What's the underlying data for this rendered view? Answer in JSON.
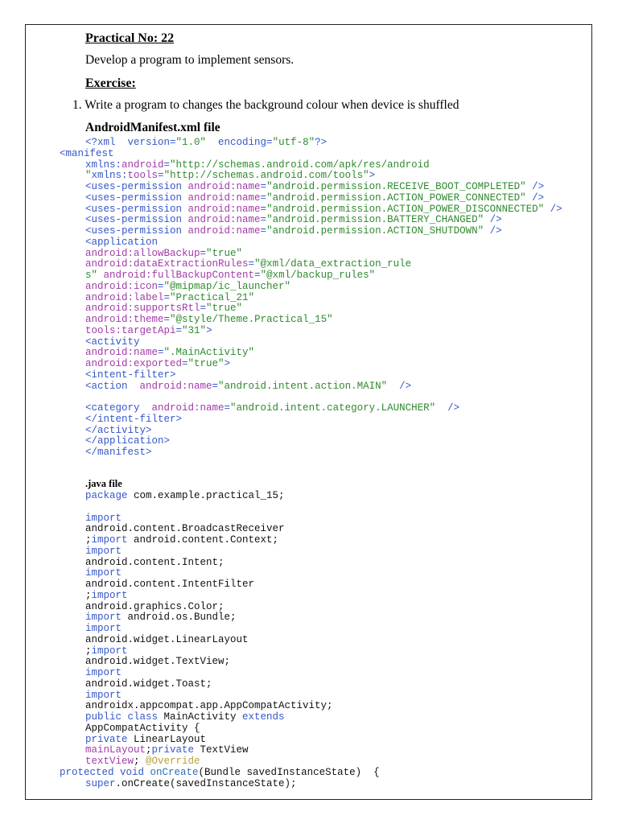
{
  "header": {
    "practical_title": "Practical No: 22",
    "aim": "Develop a program to implement sensors.",
    "exercise_heading": "Exercise:",
    "question": "1. Write a program to changes the background colour when device is shuffled",
    "manifest_heading": "AndroidManifest.xml file",
    "java_heading": ".java file"
  },
  "colors": {
    "tag": "#3557c8",
    "attr": "#a23aa8",
    "value": "#2f8a2f",
    "annotation": "#b8a03a"
  },
  "code": {
    "manifest": [
      {
        "indent": "i",
        "segs": [
          [
            "t",
            "<?xml  version="
          ],
          [
            "v",
            "\"1.0\""
          ],
          [
            "t",
            "  encoding="
          ],
          [
            "v",
            "\"utf-8\""
          ],
          [
            "t",
            "?>"
          ]
        ]
      },
      {
        "indent": "o",
        "segs": [
          [
            "t",
            "<manifest"
          ]
        ]
      },
      {
        "indent": "i",
        "segs": [
          [
            "t",
            "xmlns:"
          ],
          [
            "a",
            "android"
          ],
          [
            "t",
            "="
          ],
          [
            "v",
            "\"http://schemas.android.com/apk/res/android"
          ]
        ]
      },
      {
        "indent": "i",
        "segs": [
          [
            "v",
            "\""
          ],
          [
            "t",
            "xmlns:"
          ],
          [
            "a",
            "tools"
          ],
          [
            "t",
            "="
          ],
          [
            "v",
            "\"http://schemas.android.com/tools\""
          ],
          [
            "t",
            ">"
          ]
        ]
      },
      {
        "indent": "i",
        "segs": [
          [
            "t",
            "<uses-permission "
          ],
          [
            "a",
            "android:name"
          ],
          [
            "t",
            "="
          ],
          [
            "v",
            "\"android.permission.RECEIVE_BOOT_COMPLETED\""
          ],
          [
            "t",
            " />"
          ]
        ]
      },
      {
        "indent": "i",
        "segs": [
          [
            "t",
            "<uses-permission "
          ],
          [
            "a",
            "android:name"
          ],
          [
            "t",
            "="
          ],
          [
            "v",
            "\"android.permission.ACTION_POWER_CONNECTED\""
          ],
          [
            "t",
            " />"
          ]
        ]
      },
      {
        "indent": "i",
        "segs": [
          [
            "t",
            "<uses-permission "
          ],
          [
            "a",
            "android:name"
          ],
          [
            "t",
            "="
          ],
          [
            "v",
            "\"android.permission.ACTION_POWER_DISCONNECTED\""
          ],
          [
            "t",
            " />"
          ]
        ]
      },
      {
        "indent": "i",
        "segs": [
          [
            "t",
            "<uses-permission "
          ],
          [
            "a",
            "android:name"
          ],
          [
            "t",
            "="
          ],
          [
            "v",
            "\"android.permission.BATTERY_CHANGED\""
          ],
          [
            "t",
            " />"
          ]
        ]
      },
      {
        "indent": "i",
        "segs": [
          [
            "t",
            "<uses-permission "
          ],
          [
            "a",
            "android:name"
          ],
          [
            "t",
            "="
          ],
          [
            "v",
            "\"android.permission.ACTION_SHUTDOWN\""
          ],
          [
            "t",
            " />"
          ]
        ]
      },
      {
        "indent": "i",
        "segs": [
          [
            "t",
            "<application"
          ]
        ]
      },
      {
        "indent": "i",
        "segs": [
          [
            "a",
            "android:allowBackup"
          ],
          [
            "t",
            "="
          ],
          [
            "v",
            "\"true\""
          ]
        ]
      },
      {
        "indent": "i",
        "segs": [
          [
            "a",
            "android:dataExtractionRules"
          ],
          [
            "t",
            "="
          ],
          [
            "v",
            "\"@xml/data_extraction_rule"
          ]
        ]
      },
      {
        "indent": "i",
        "segs": [
          [
            "v",
            "s\" "
          ],
          [
            "a",
            "android:fullBackupContent"
          ],
          [
            "t",
            "="
          ],
          [
            "v",
            "\"@xml/backup_rules\""
          ]
        ]
      },
      {
        "indent": "i",
        "segs": [
          [
            "a",
            "android:icon"
          ],
          [
            "t",
            "="
          ],
          [
            "v",
            "\"@mipmap/ic_launcher\""
          ]
        ]
      },
      {
        "indent": "i",
        "segs": [
          [
            "a",
            "android:label"
          ],
          [
            "t",
            "="
          ],
          [
            "v",
            "\"Practical_21\""
          ]
        ]
      },
      {
        "indent": "i",
        "segs": [
          [
            "a",
            "android:supportsRtl"
          ],
          [
            "t",
            "="
          ],
          [
            "v",
            "\"true\""
          ]
        ]
      },
      {
        "indent": "i",
        "segs": [
          [
            "a",
            "android:theme"
          ],
          [
            "t",
            "="
          ],
          [
            "v",
            "\"@style/Theme.Practical_15\""
          ]
        ]
      },
      {
        "indent": "i",
        "segs": [
          [
            "a",
            "tools:targetApi"
          ],
          [
            "t",
            "="
          ],
          [
            "v",
            "\"31\""
          ],
          [
            "t",
            ">"
          ]
        ]
      },
      {
        "indent": "i",
        "segs": [
          [
            "t",
            "<activity"
          ]
        ]
      },
      {
        "indent": "i",
        "segs": [
          [
            "a",
            "android:name"
          ],
          [
            "t",
            "="
          ],
          [
            "v",
            "\".MainActivity\""
          ]
        ]
      },
      {
        "indent": "i",
        "segs": [
          [
            "a",
            "android:exported"
          ],
          [
            "t",
            "="
          ],
          [
            "v",
            "\"true\""
          ],
          [
            "t",
            ">"
          ]
        ]
      },
      {
        "indent": "i",
        "segs": [
          [
            "t",
            "<intent-filter>"
          ]
        ]
      },
      {
        "indent": "i",
        "segs": [
          [
            "t",
            "<action  "
          ],
          [
            "a",
            "android:name"
          ],
          [
            "t",
            "="
          ],
          [
            "v",
            "\"android.intent.action.MAIN\""
          ],
          [
            "t",
            "  />"
          ]
        ]
      },
      {
        "indent": "i",
        "segs": []
      },
      {
        "indent": "i",
        "segs": [
          [
            "t",
            "<category  "
          ],
          [
            "a",
            "android:name"
          ],
          [
            "t",
            "="
          ],
          [
            "v",
            "\"android.intent.category.LAUNCHER\""
          ],
          [
            "t",
            "  />"
          ]
        ]
      },
      {
        "indent": "i",
        "segs": [
          [
            "t",
            "</intent-filter>"
          ]
        ]
      },
      {
        "indent": "i",
        "segs": [
          [
            "t",
            "</activity>"
          ]
        ]
      },
      {
        "indent": "i",
        "segs": [
          [
            "t",
            "</application>"
          ]
        ]
      },
      {
        "indent": "i",
        "segs": [
          [
            "t",
            "</manifest>"
          ]
        ]
      }
    ],
    "java": [
      {
        "indent": "i",
        "segs": [
          [
            "k",
            "package"
          ],
          [
            "p0",
            " com.example.practical_15;"
          ]
        ]
      },
      {
        "indent": "i",
        "segs": []
      },
      {
        "indent": "i",
        "segs": [
          [
            "k",
            "import"
          ]
        ]
      },
      {
        "indent": "i",
        "segs": [
          [
            "p0",
            "android.content.BroadcastReceiver"
          ]
        ]
      },
      {
        "indent": "i",
        "segs": [
          [
            "p0",
            ";"
          ],
          [
            "k",
            "import"
          ],
          [
            "p0",
            " android.content.Context;"
          ]
        ]
      },
      {
        "indent": "i",
        "segs": [
          [
            "k",
            "import"
          ]
        ]
      },
      {
        "indent": "i",
        "segs": [
          [
            "p0",
            "android.content.Intent;"
          ]
        ]
      },
      {
        "indent": "i",
        "segs": [
          [
            "k",
            "import"
          ]
        ]
      },
      {
        "indent": "i",
        "segs": [
          [
            "p0",
            "android.content.IntentFilter"
          ]
        ]
      },
      {
        "indent": "i",
        "segs": [
          [
            "p0",
            ";"
          ],
          [
            "k",
            "import"
          ]
        ]
      },
      {
        "indent": "i",
        "segs": [
          [
            "p0",
            "android.graphics.Color;"
          ]
        ]
      },
      {
        "indent": "i",
        "segs": [
          [
            "k",
            "import"
          ],
          [
            "p0",
            " android.os.Bundle;"
          ]
        ]
      },
      {
        "indent": "i",
        "segs": [
          [
            "k",
            "import"
          ]
        ]
      },
      {
        "indent": "i",
        "segs": [
          [
            "p0",
            "android.widget.LinearLayout"
          ]
        ]
      },
      {
        "indent": "i",
        "segs": [
          [
            "p0",
            ";"
          ],
          [
            "k",
            "import"
          ]
        ]
      },
      {
        "indent": "i",
        "segs": [
          [
            "p0",
            "android.widget.TextView;"
          ]
        ]
      },
      {
        "indent": "i",
        "segs": [
          [
            "k",
            "import"
          ]
        ]
      },
      {
        "indent": "i",
        "segs": [
          [
            "p0",
            "android.widget.Toast;"
          ]
        ]
      },
      {
        "indent": "i",
        "segs": [
          [
            "k",
            "import"
          ]
        ]
      },
      {
        "indent": "i",
        "segs": [
          [
            "p0",
            "androidx.appcompat.app.AppCompatActivity;"
          ]
        ]
      },
      {
        "indent": "i",
        "segs": [
          [
            "k",
            "public class"
          ],
          [
            "p0",
            " MainActivity "
          ],
          [
            "k",
            "extends"
          ]
        ]
      },
      {
        "indent": "i",
        "segs": [
          [
            "p0",
            "AppCompatActivity {"
          ]
        ]
      },
      {
        "indent": "i",
        "segs": [
          [
            "k",
            "private"
          ],
          [
            "p0",
            " LinearLayout"
          ]
        ]
      },
      {
        "indent": "i",
        "segs": [
          [
            "m",
            "mainLayout"
          ],
          [
            "p0",
            ";"
          ],
          [
            "k",
            "private"
          ],
          [
            "p0",
            " TextView"
          ]
        ]
      },
      {
        "indent": "i",
        "segs": [
          [
            "m",
            "textView"
          ],
          [
            "p0",
            "; "
          ],
          [
            "y",
            "@Override"
          ]
        ]
      },
      {
        "indent": "o",
        "segs": [
          [
            "k",
            "protected void "
          ],
          [
            "f",
            "onCreate"
          ],
          [
            "p0",
            "(Bundle savedInstanceState)  {"
          ]
        ]
      },
      {
        "indent": "i",
        "segs": [
          [
            "k",
            "super"
          ],
          [
            "p0",
            ".onCreate(savedInstanceState);"
          ]
        ]
      }
    ]
  }
}
